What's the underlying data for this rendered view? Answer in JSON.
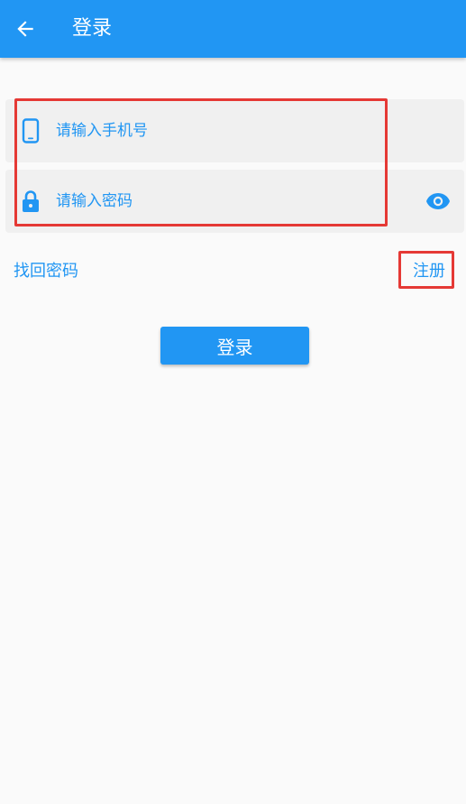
{
  "appbar": {
    "title": "登录",
    "back_icon": "arrow-left-icon"
  },
  "form": {
    "phone": {
      "placeholder": "请输入手机号",
      "value": "",
      "icon": "phone-icon"
    },
    "password": {
      "placeholder": "请输入密码",
      "value": "",
      "icon": "lock-icon",
      "toggle_icon": "eye-icon"
    }
  },
  "links": {
    "forgot_password": "找回密码",
    "register": "注册"
  },
  "login_button": {
    "label": "登录"
  },
  "colors": {
    "primary": "#2196f3",
    "background": "#fafafa",
    "field_background": "#f0f0f0",
    "highlight": "#e53935"
  }
}
